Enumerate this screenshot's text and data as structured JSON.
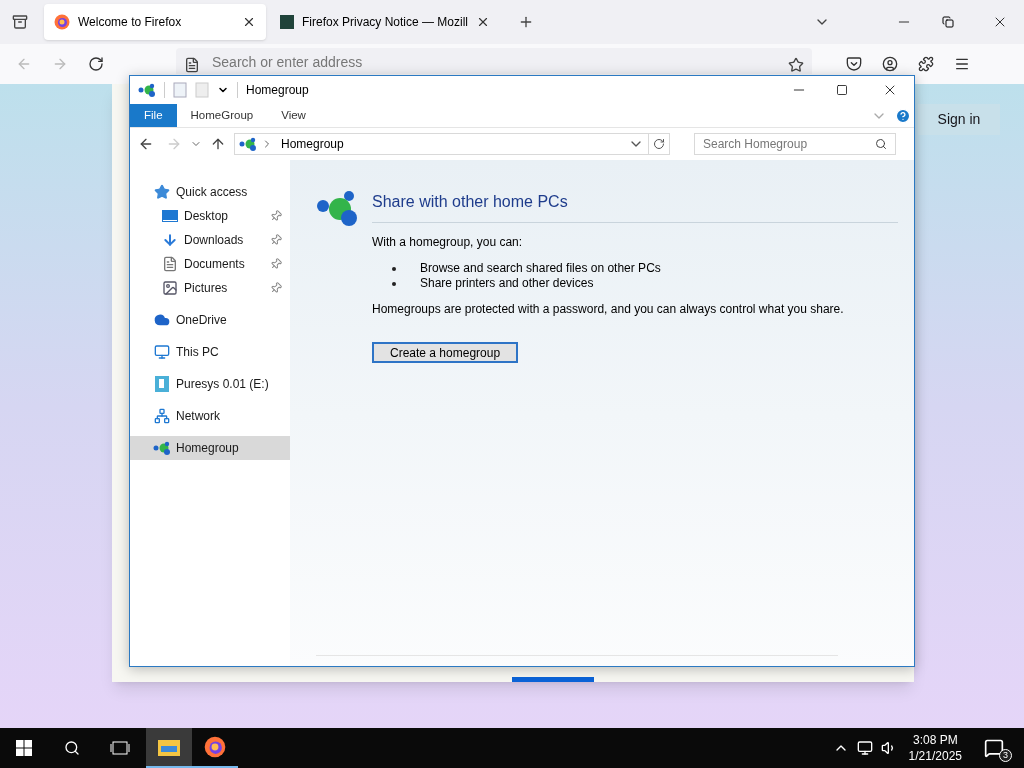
{
  "browser": {
    "tabs": [
      {
        "title": "Welcome to Firefox",
        "selected": true,
        "kind": "firefox"
      },
      {
        "title": "Firefox Privacy Notice — Mozill",
        "selected": false,
        "kind": "page"
      }
    ],
    "address_placeholder": "Search or enter address",
    "sign_in": "Sign in"
  },
  "explorer": {
    "title": "Homegroup",
    "ribbon_tabs": [
      {
        "label": "File",
        "selected": true
      },
      {
        "label": "HomeGroup",
        "selected": false
      },
      {
        "label": "View",
        "selected": false
      }
    ],
    "address": "Homegroup",
    "search_placeholder": "Search Homegroup",
    "nav": [
      {
        "label": "Quick access",
        "kind": "star",
        "selected": false,
        "children": [
          {
            "label": "Desktop",
            "kind": "desktop",
            "pinned": true,
            "selected": false
          },
          {
            "label": "Downloads",
            "kind": "download",
            "pinned": true,
            "selected": false
          },
          {
            "label": "Documents",
            "kind": "document",
            "pinned": true,
            "selected": false
          },
          {
            "label": "Pictures",
            "kind": "picture",
            "pinned": true,
            "selected": false
          }
        ]
      },
      {
        "label": "OneDrive",
        "kind": "cloud",
        "selected": false
      },
      {
        "label": "This PC",
        "kind": "pc",
        "selected": false
      },
      {
        "label": "Puresys 0.01 (E:)",
        "kind": "drive",
        "selected": false
      },
      {
        "label": "Network",
        "kind": "network",
        "selected": false
      },
      {
        "label": "Homegroup",
        "kind": "homegroup",
        "selected": true
      }
    ],
    "heading": "Share with other home PCs",
    "intro": "With a homegroup, you can:",
    "bullets": [
      "Browse and search shared files on other PCs",
      "Share printers and other devices"
    ],
    "note": "Homegroups are protected with a password, and you can always control what you share.",
    "button": "Create a homegroup"
  },
  "taskbar": {
    "apps": [
      {
        "kind": "explorer",
        "active": true
      },
      {
        "kind": "firefox",
        "active": false
      }
    ],
    "time": "3:08 PM",
    "date": "1/21/2025",
    "notifications": "3"
  }
}
